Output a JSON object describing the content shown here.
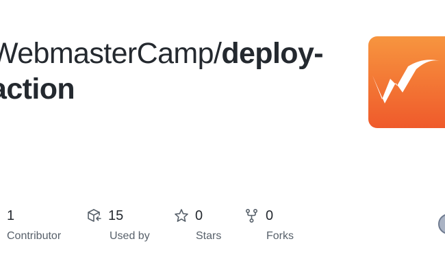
{
  "repo": {
    "owner": "WebmasterCamp/",
    "name_line1": "deploy-",
    "name_line2": "action"
  },
  "logo": {
    "icon": "webmastercamp-logo-icon",
    "gradient_top": "#f7953f",
    "gradient_bottom": "#ef5a2b"
  },
  "stats": [
    {
      "icon": "people-icon",
      "value": "1",
      "label": "Contributor"
    },
    {
      "icon": "package-dependents-icon",
      "value": "15",
      "label": "Used by"
    },
    {
      "icon": "star-icon",
      "value": "0",
      "label": "Stars"
    },
    {
      "icon": "repo-forked-icon",
      "value": "0",
      "label": "Forks"
    }
  ],
  "colors": {
    "text": "#24292f",
    "muted": "#57606a",
    "icon": "#57606a"
  }
}
